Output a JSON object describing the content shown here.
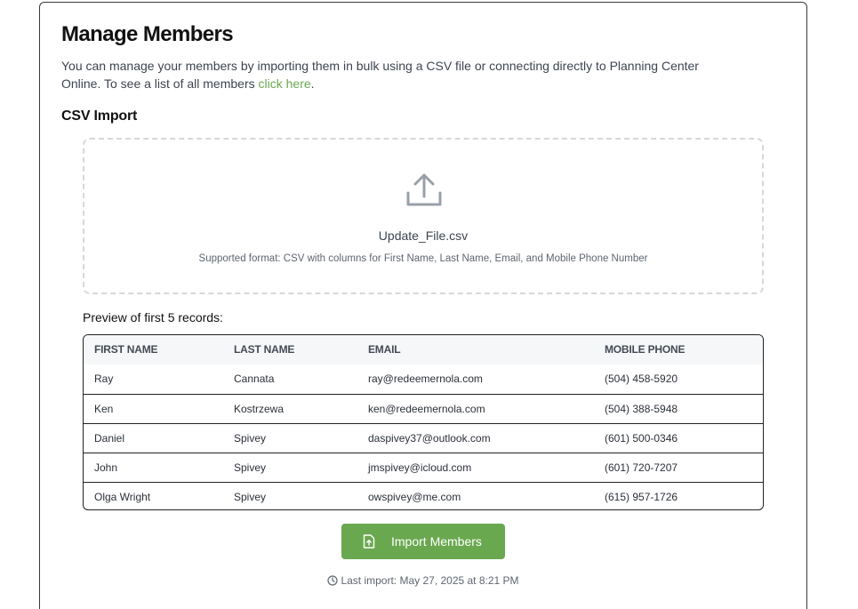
{
  "header": {
    "title": "Manage Members",
    "description_prefix": "You can manage your members by importing them in bulk using a CSV file or connecting directly to Planning Center Online. To see a list of all members ",
    "link_text": "click here",
    "description_suffix": "."
  },
  "csv_import": {
    "section_title": "CSV Import",
    "upload_icon": "upload-icon",
    "file_name": "Update_File.csv",
    "format_text": "Supported format: CSV with columns for First Name, Last Name, Email, and Mobile Phone Number"
  },
  "preview": {
    "title": "Preview of first 5 records:",
    "columns": [
      "FIRST NAME",
      "LAST NAME",
      "EMAIL",
      "MOBILE PHONE"
    ],
    "rows": [
      [
        "Ray",
        "Cannata",
        "ray@redeemernola.com",
        "(504) 458-5920"
      ],
      [
        "Ken",
        "Kostrzewa",
        "ken@redeemernola.com",
        "(504) 388-5948"
      ],
      [
        "Daniel",
        "Spivey",
        "daspivey37@outlook.com",
        "(601) 500-0346"
      ],
      [
        "John",
        "Spivey",
        "jmspivey@icloud.com",
        "(601) 720-7207"
      ],
      [
        "Olga Wright",
        "Spivey",
        "owspivey@me.com",
        "(615) 957-1726"
      ]
    ]
  },
  "actions": {
    "import_label": "Import Members",
    "import_icon": "file-upload-icon"
  },
  "status": {
    "last_import": "Last import: May 27, 2025 at 8:21 PM",
    "clock_icon": "clock-icon"
  },
  "colors": {
    "accent": "#6aa84f",
    "border": "#222222"
  }
}
